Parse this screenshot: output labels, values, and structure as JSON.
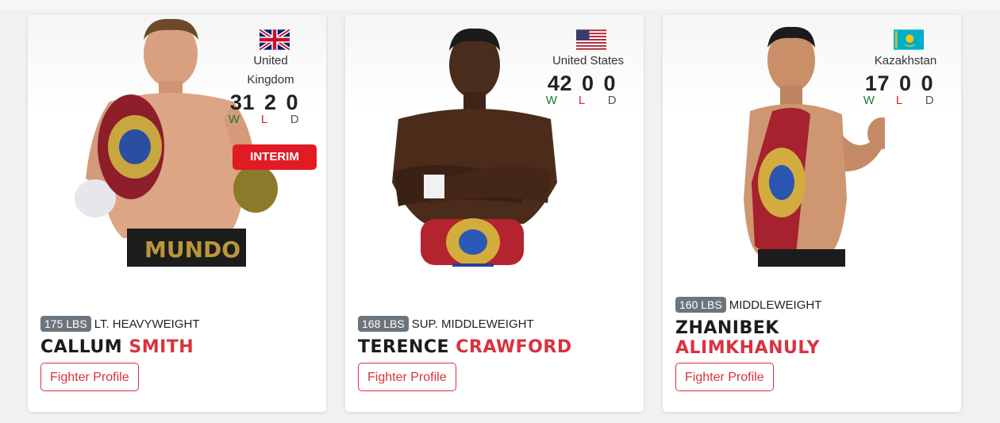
{
  "fighters": [
    {
      "country": "United Kingdom",
      "record": {
        "wins": "31",
        "losses": "2",
        "draws": "0"
      },
      "record_labels": {
        "w": "W",
        "l": "L",
        "d": "D"
      },
      "status_badge": "INTERIM",
      "weight": "175 LBS",
      "division": "LT. HEAVYWEIGHT",
      "first_name": "CALLUM",
      "last_name": "SMITH",
      "profile_button": "Fighter Profile",
      "belt_text": "MUNDO"
    },
    {
      "country": "United States",
      "record": {
        "wins": "42",
        "losses": "0",
        "draws": "0"
      },
      "record_labels": {
        "w": "W",
        "l": "L",
        "d": "D"
      },
      "weight": "168 LBS",
      "division": "SUP. MIDDLEWEIGHT",
      "first_name": "TERENCE",
      "last_name": "CRAWFORD",
      "profile_button": "Fighter Profile"
    },
    {
      "country": "Kazakhstan",
      "record": {
        "wins": "17",
        "losses": "0",
        "draws": "0"
      },
      "record_labels": {
        "w": "W",
        "l": "L",
        "d": "D"
      },
      "weight": "160 LBS",
      "division": "MIDDLEWEIGHT",
      "first_name": "ZHANIBEK",
      "last_name": "ALIMKHANULY",
      "profile_button": "Fighter Profile"
    }
  ],
  "colors": {
    "accent_red": "#d9323e",
    "interim_red": "#e01b24",
    "win_green": "#1a7a3a",
    "weight_pill_gray": "#6c757d"
  },
  "icons": [
    "uk-flag-icon",
    "us-flag-icon",
    "kazakhstan-flag-icon"
  ]
}
